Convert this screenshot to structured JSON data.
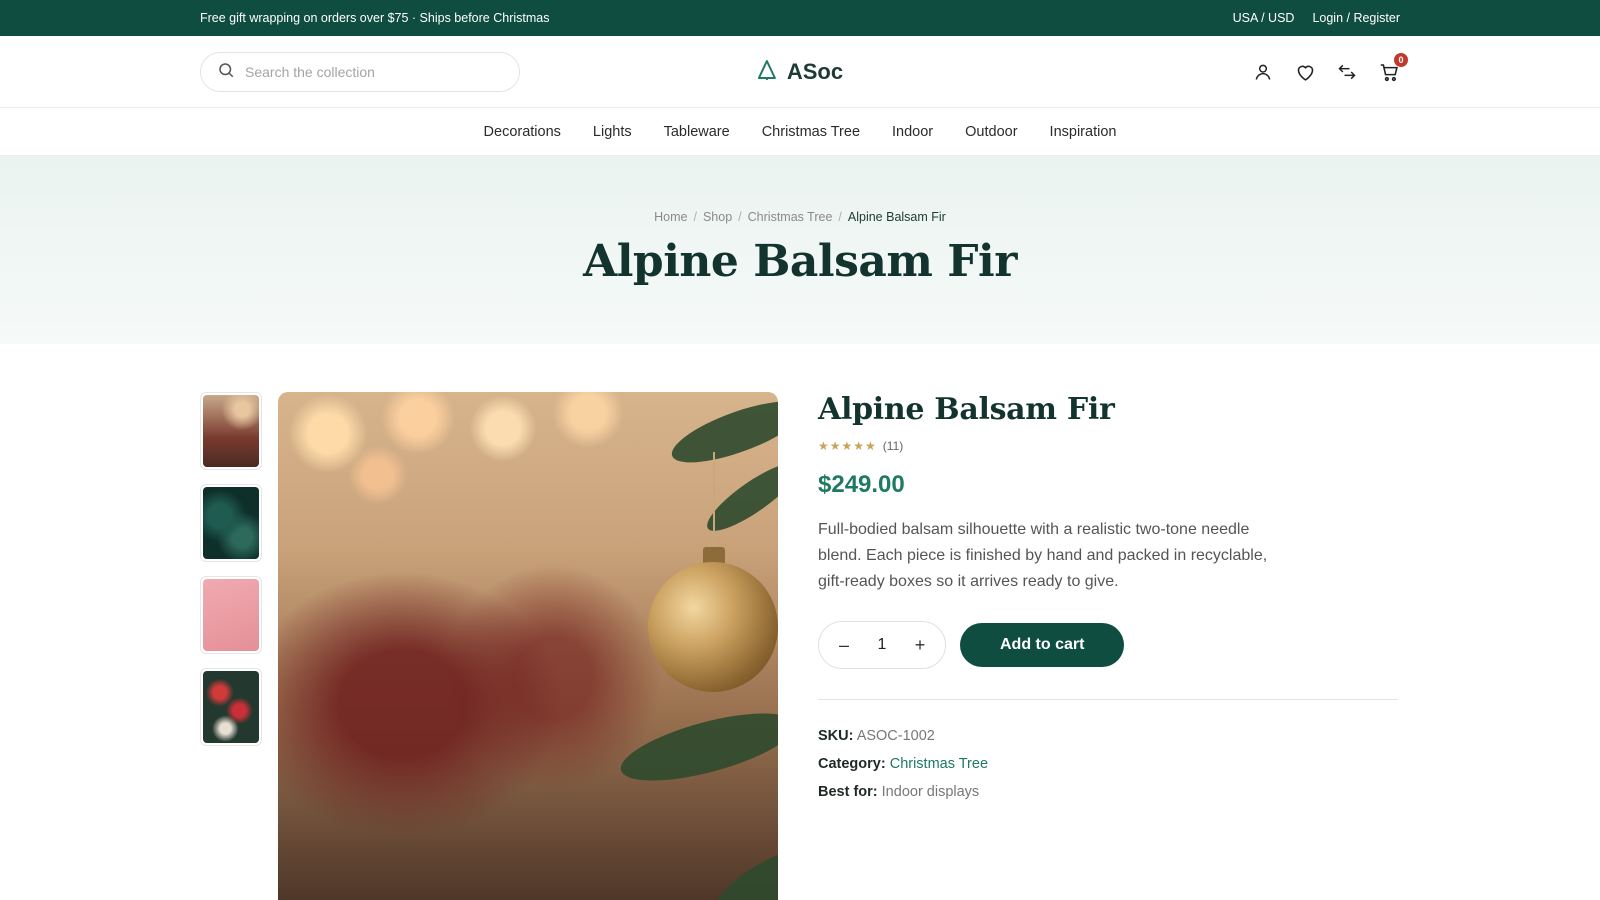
{
  "topbar": {
    "promo": "Free gift wrapping on orders over $75 · Ships before Christmas",
    "locale": "USA / USD",
    "account": "Login / Register"
  },
  "header": {
    "search_placeholder": "Search the collection",
    "logo": "ASoc",
    "cart_count": "0",
    "icons": [
      "account-icon",
      "heart-icon",
      "compare-icon",
      "cart-icon"
    ]
  },
  "nav": {
    "items": [
      "Decorations",
      "Lights",
      "Tableware",
      "Christmas Tree",
      "Indoor",
      "Outdoor",
      "Inspiration"
    ]
  },
  "hero": {
    "breadcrumb": [
      "Home",
      "Shop",
      "Christmas Tree",
      "Alpine Balsam Fir"
    ],
    "title": "Alpine Balsam Fir"
  },
  "product": {
    "name": "Alpine Balsam Fir",
    "rating_stars": "★★★★★",
    "rating_value": 4.5,
    "rating_count": "(11)",
    "price": "$249.00",
    "description": "Full-bodied balsam silhouette with a realistic two-tone needle blend. Each piece is finished by hand and packed in recyclable, gift-ready boxes so it arrives ready to give.",
    "quantity": "1",
    "qty_minus": "–",
    "qty_plus": "+",
    "add_to_cart": "Add to cart",
    "meta": {
      "sku_label": "SKU:",
      "sku": "ASOC-1002",
      "category_label": "Category:",
      "category": "Christmas Tree",
      "bestfor_label": "Best for:",
      "bestfor": "Indoor displays"
    }
  },
  "colors": {
    "brand": "#0e4d40",
    "accent": "#1e7a62",
    "star": "#c8a35a",
    "badge": "#c0392b"
  }
}
